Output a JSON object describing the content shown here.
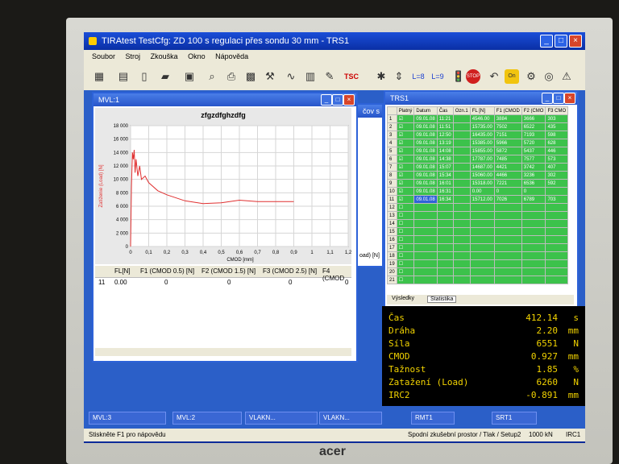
{
  "brand": "acer",
  "app": {
    "title": "TIRAtest   TestCfg: ZD 100 s regulaci přes sondu 30 mm - TRS1",
    "menu": [
      "Soubor",
      "Stroj",
      "Zkouška",
      "Okno",
      "Nápověda"
    ],
    "toolbar_labels": [
      "TSC",
      "L=8",
      "L=9"
    ]
  },
  "mvl1": {
    "title": "MVL:1",
    "chart": {
      "title": "zfgzdfghzdfg",
      "ylabel": "Zatíženie (Load) [N]",
      "xlabel": "CMOD [mm]",
      "xticks": [
        "0",
        "0,1",
        "0,2",
        "0,3",
        "0,4",
        "0,5",
        "0,6",
        "0,7",
        "0,8",
        "0,9",
        "1",
        "1,1",
        "1,2"
      ],
      "yticks": [
        "0",
        "2 000",
        "4 000",
        "6 000",
        "8 000",
        "10 000",
        "12 000",
        "14 000",
        "16 000",
        "18 000"
      ]
    },
    "table": {
      "headers": [
        "FL[N]",
        "F1 (CMOD 0.5) [N]",
        "F2 (CMOD 1.5) [N]",
        "F3 (CMOD 2.5) [N]",
        "F4 (CMOD"
      ],
      "row": {
        "id": "11",
        "values": [
          "0.00",
          "0",
          "0",
          "0",
          "0"
        ]
      }
    }
  },
  "partial_win": {
    "title_fragment": "čov s",
    "label": "oad) [N]"
  },
  "trs1": {
    "title": "TRS1",
    "headers": [
      "Platný",
      "Datum",
      "Čas",
      "Ozn.1",
      "FL [N]",
      "F1 (CMOD",
      "F2 (CMO",
      "F3 CMO"
    ],
    "rows": [
      {
        "n": "1",
        "date": "09.01.08",
        "time": "11:21",
        "fl": "4546.00",
        "f1": "3884",
        "f2": "3666",
        "f3": "303"
      },
      {
        "n": "2",
        "date": "09.01.08",
        "time": "11:51",
        "fl": "15735.00",
        "f1": "7502",
        "f2": "6522",
        "f3": "435"
      },
      {
        "n": "3",
        "date": "09.01.08",
        "time": "12:50",
        "fl": "16435.00",
        "f1": "7151",
        "f2": "7193",
        "f3": "598"
      },
      {
        "n": "4",
        "date": "09.01.08",
        "time": "13:19",
        "fl": "15385.00",
        "f1": "5966",
        "f2": "5720",
        "f3": "628"
      },
      {
        "n": "5",
        "date": "09.01.08",
        "time": "14:08",
        "fl": "15855.00",
        "f1": "5872",
        "f2": "5437",
        "f3": "446"
      },
      {
        "n": "6",
        "date": "09.01.08",
        "time": "14:38",
        "fl": "17787.00",
        "f1": "7485",
        "f2": "7577",
        "f3": "573"
      },
      {
        "n": "7",
        "date": "09.01.08",
        "time": "15:07",
        "fl": "14687.00",
        "f1": "4421",
        "f2": "3742",
        "f3": "407"
      },
      {
        "n": "8",
        "date": "09.01.08",
        "time": "15:34",
        "fl": "15060.00",
        "f1": "4466",
        "f2": "3236",
        "f3": "302"
      },
      {
        "n": "9",
        "date": "09.01.08",
        "time": "16:01",
        "fl": "15318.00",
        "f1": "7221",
        "f2": "6536",
        "f3": "592"
      },
      {
        "n": "10",
        "date": "09.01.08",
        "time": "16:31",
        "fl": "0.00",
        "f1": "0",
        "f2": "0",
        "f3": ""
      },
      {
        "n": "11",
        "date": "09.01.08",
        "time": "16:34",
        "fl": "15712.00",
        "f1": "7026",
        "f2": "6789",
        "f3": "703"
      }
    ],
    "empty_rows": [
      "12",
      "13",
      "14",
      "15",
      "16",
      "17",
      "18",
      "19",
      "20",
      "21"
    ],
    "tabs": [
      "Výsledky",
      "Statistika"
    ]
  },
  "readout": [
    {
      "k": "Čas",
      "v": "412.14",
      "u": "s"
    },
    {
      "k": "Dráha",
      "v": "2.20",
      "u": "mm"
    },
    {
      "k": "Síla",
      "v": "6551",
      "u": "N"
    },
    {
      "k": "CMOD",
      "v": "0.927",
      "u": "mm"
    },
    {
      "k": "Tažnost",
      "v": "1.85",
      "u": "%"
    },
    {
      "k": "Zatažení (Load)",
      "v": "6260",
      "u": "N"
    },
    {
      "k": "IRC2",
      "v": "-0.891",
      "u": "mm"
    }
  ],
  "taskbar": [
    "MVL:3",
    "MVL:2",
    "VLAKN...",
    "VLAKN...",
    "RMT1",
    "SRT1"
  ],
  "status": {
    "left": "Stiskněte F1 pro nápovědu",
    "mid": "Spodní zkušební prostor / Tlak / Setup2",
    "right": "1000 kN",
    "right2": "IRC1"
  }
}
